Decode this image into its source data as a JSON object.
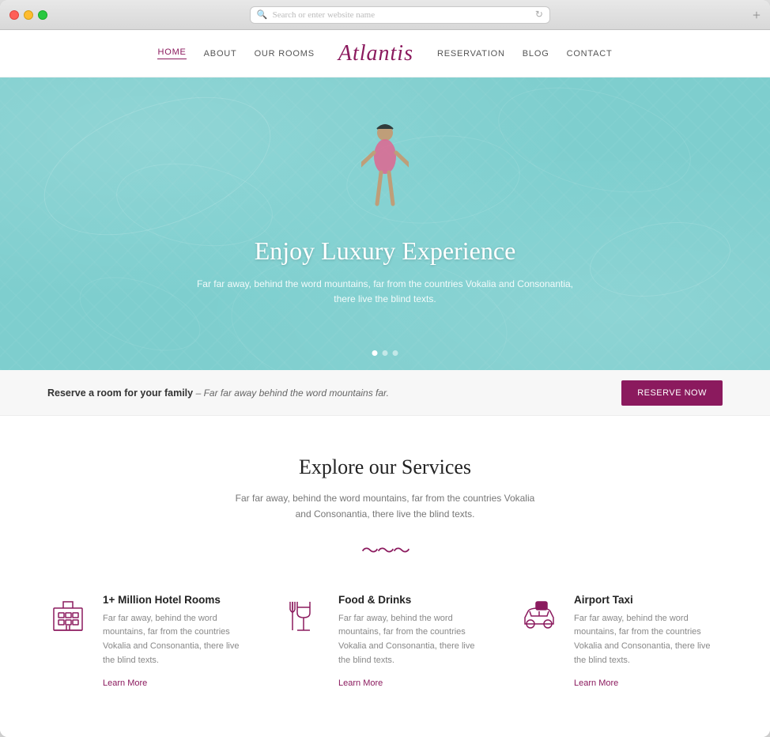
{
  "browser": {
    "address_placeholder": "Search or enter website name"
  },
  "navbar": {
    "brand": "Atlantis",
    "links_left": [
      "HOME",
      "ABOUT",
      "OUR ROOMS"
    ],
    "links_right": [
      "RESERVATION",
      "BLOG",
      "CONTACT"
    ],
    "active_link": "HOME"
  },
  "hero": {
    "title": "Enjoy Luxury Experience",
    "subtitle": "Far far away, behind the word mountains, far from the countries Vokalia and Consonantia, there live the blind texts.",
    "dots": [
      true,
      false,
      false
    ]
  },
  "reserve_banner": {
    "main_text": "Reserve a room for your family",
    "sub_text": "– Far far away behind the word mountains far.",
    "button_label": "Reserve now"
  },
  "services": {
    "title": "Explore our Services",
    "subtitle": "Far far away, behind the word mountains, far from the countries Vokalia and Consonantia, there live the blind texts.",
    "items": [
      {
        "icon": "hotel",
        "title": "1+ Million Hotel Rooms",
        "desc": "Far far away, behind the word mountains, far from the countries Vokalia and Consonantia, there live the blind texts.",
        "link": "Learn More"
      },
      {
        "icon": "food",
        "title": "Food & Drinks",
        "desc": "Far far away, behind the word mountains, far from the countries Vokalia and Consonantia, there live the blind texts.",
        "link": "Learn More"
      },
      {
        "icon": "taxi",
        "title": "Airport Taxi",
        "desc": "Far far away, behind the word mountains, far from the countries Vokalia and Consonantia, there live the blind texts.",
        "link": "Learn More"
      }
    ]
  },
  "colors": {
    "brand": "#8b1a5e",
    "hero_bg": "#7ecece"
  }
}
